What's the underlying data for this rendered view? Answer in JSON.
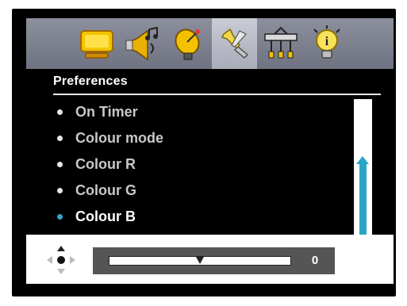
{
  "toolbar": {
    "tabs": [
      {
        "icon": "monitor-icon"
      },
      {
        "icon": "speaker-music-icon"
      },
      {
        "icon": "satellite-dish-icon"
      },
      {
        "icon": "tools-icon"
      },
      {
        "icon": "connector-icon"
      },
      {
        "icon": "info-bulb-icon"
      }
    ],
    "active_index": 3
  },
  "menu": {
    "title": "Preferences",
    "items": [
      {
        "label": "On Timer",
        "selected": false
      },
      {
        "label": "Colour mode",
        "selected": false
      },
      {
        "label": "Colour R",
        "selected": false
      },
      {
        "label": "Colour G",
        "selected": false
      },
      {
        "label": "Colour B",
        "selected": true
      }
    ]
  },
  "scrollbar": {
    "direction": "up"
  },
  "adjust": {
    "value": "0",
    "slider_position_percent": 50
  },
  "colors": {
    "accent": "#2aa6c4",
    "background": "#000000",
    "toolbar": "#7d808d"
  }
}
